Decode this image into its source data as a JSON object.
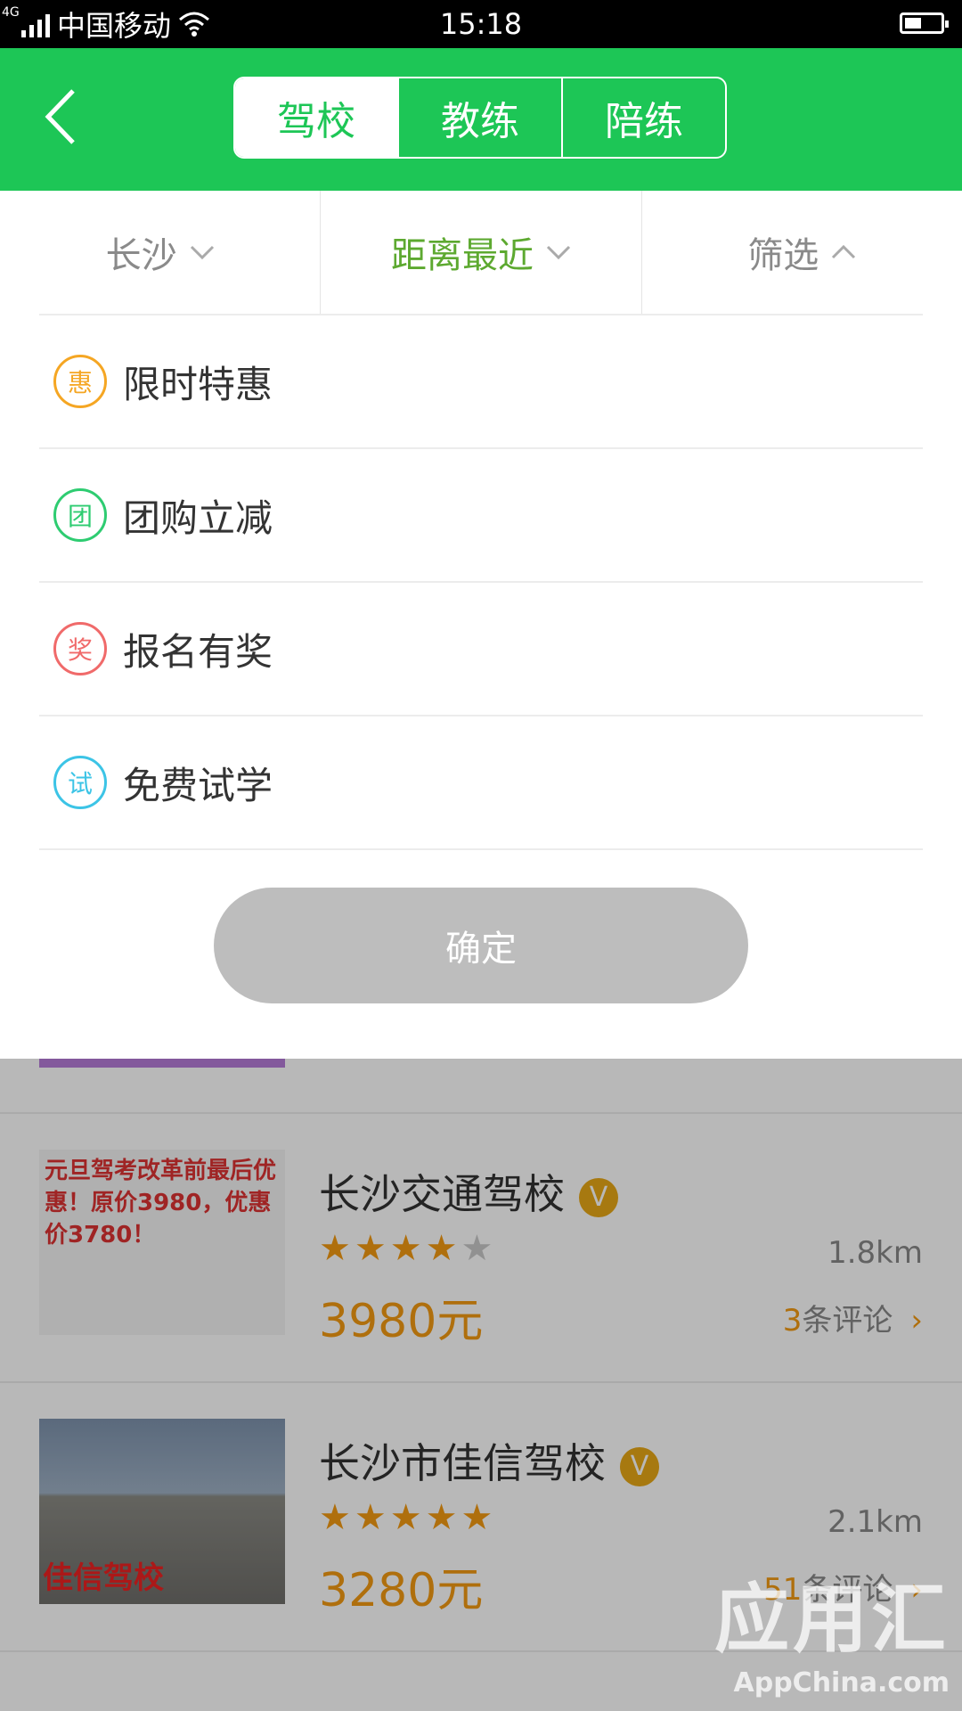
{
  "status_bar": {
    "network": "4G",
    "carrier": "中国移动",
    "time": "15:18"
  },
  "header": {
    "tabs": [
      "驾校",
      "教练",
      "陪练"
    ],
    "active_tab": "驾校",
    "accent_color": "#1dc656"
  },
  "filters": {
    "city": "长沙",
    "sort": "距离最近",
    "filter": "筛选"
  },
  "options": [
    {
      "icon_text": "惠",
      "label": "限时特惠",
      "color": "#f5a623"
    },
    {
      "icon_text": "团",
      "label": "团购立减",
      "color": "#2ecc71"
    },
    {
      "icon_text": "奖",
      "label": "报名有奖",
      "color": "#f06a6a"
    },
    {
      "icon_text": "试",
      "label": "免费试学",
      "color": "#3cc4e6"
    }
  ],
  "confirm_label": "确定",
  "list": [
    {
      "name": "长沙交通驾校",
      "verified_mark": "V",
      "rating": 4.5,
      "distance": "1.8km",
      "price": "3980元",
      "review_count": "3",
      "review_suffix": "条评论",
      "thumb_text": "元旦驾考改革前最后优惠！原价3980，优惠价3780！"
    },
    {
      "name": "长沙市佳信驾校",
      "verified_mark": "V",
      "rating": 5,
      "distance": "2.1km",
      "price": "3280元",
      "review_count": "51",
      "review_suffix": "条评论",
      "thumb_text": "佳信驾校"
    }
  ],
  "watermark": {
    "title": "应用汇",
    "subtitle": "AppChina.com"
  }
}
